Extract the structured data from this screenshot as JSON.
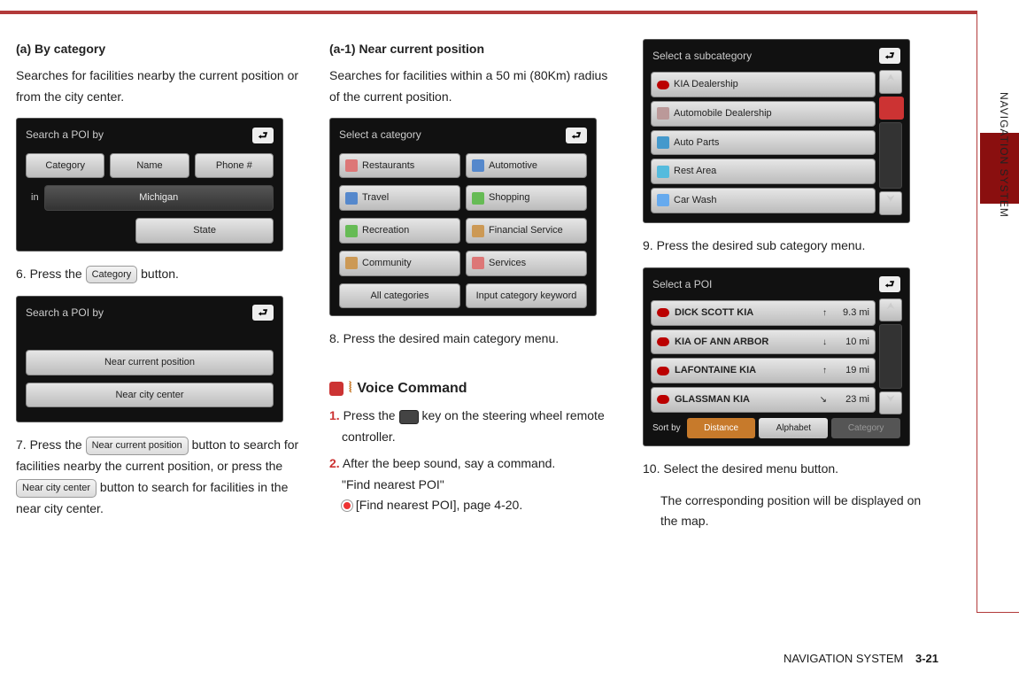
{
  "side_label": "NAVIGATION SYSTEM",
  "footer": {
    "section": "NAVIGATION SYSTEM",
    "page": "3-21"
  },
  "col1": {
    "heading": "(a) By category",
    "intro": "Searches for facilities nearby the current position or from the city center.",
    "ui1": {
      "title": "Search a POI by",
      "buttons": [
        "Category",
        "Name",
        "Phone #"
      ],
      "in_label": "in",
      "state_name": "Michigan",
      "state_btn": "State"
    },
    "step6_pre": "6. Press the ",
    "step6_btn": "Category",
    "step6_post": " button.",
    "ui2": {
      "title": "Search a POI by",
      "options": [
        "Near current position",
        "Near city center"
      ]
    },
    "step7_pre": "7. Press the ",
    "step7_btn1": "Near current position",
    "step7_mid": " button to search for facilities nearby the current position, or press the ",
    "step7_btn2": "Near city center",
    "step7_post": " button to search for facilities in the near city center."
  },
  "col2": {
    "heading": "(a-1) Near current position",
    "intro": "Searches for facilities within a 50 mi (80Km) radius of the current position.",
    "ui3": {
      "title": "Select a category",
      "left": [
        "Restaurants",
        "Travel",
        "Recreation",
        "Community"
      ],
      "right": [
        "Automotive",
        "Shopping",
        "Financial Service",
        "Services"
      ],
      "bottom": [
        "All categories",
        "Input category keyword"
      ]
    },
    "step8": "8. Press the desired main category menu.",
    "vc": {
      "title": "Voice Command",
      "s1a": "Press the ",
      "s1b": " key on the steering wheel remote controller.",
      "s2": "After the beep sound, say a command.",
      "s2q": "\"Find nearest POI\"",
      "s2r": "[Find nearest POI], page 4-20."
    }
  },
  "col3": {
    "ui4": {
      "title": "Select a subcategory",
      "items": [
        "KIA Dealership",
        "Automobile Dealership",
        "Auto Parts",
        "Rest Area",
        "Car Wash"
      ]
    },
    "step9": "9. Press the desired sub category menu.",
    "ui5": {
      "title": "Select a POI",
      "rows": [
        {
          "name": "DICK SCOTT KIA",
          "dir": "↑",
          "dist": "9.3 mi"
        },
        {
          "name": "KIA OF ANN ARBOR",
          "dir": "↓",
          "dist": "10 mi"
        },
        {
          "name": "LAFONTAINE KIA",
          "dir": "↑",
          "dist": "19 mi"
        },
        {
          "name": "GLASSMAN KIA",
          "dir": "↘",
          "dist": "23 mi"
        }
      ],
      "sort_label": "Sort by",
      "sort": [
        "Distance",
        "Alphabet",
        "Category"
      ]
    },
    "step10a": "10. Select the desired menu button.",
    "step10b": "The corresponding position will be displayed on the map."
  }
}
